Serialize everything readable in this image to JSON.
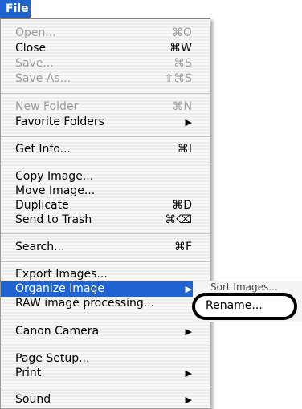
{
  "menubar": {
    "title": "File"
  },
  "menu": {
    "items": [
      {
        "label": "Open...",
        "shortcut": "⌘O",
        "disabled": true
      },
      {
        "label": "Close",
        "shortcut": "⌘W"
      },
      {
        "label": "Save...",
        "shortcut": "⌘S",
        "disabled": true
      },
      {
        "label": "Save As...",
        "shortcut": "⇧⌘S",
        "disabled": true
      },
      {
        "label": "New Folder",
        "shortcut": "⌘N",
        "disabled": true
      },
      {
        "label": "Favorite Folders",
        "submenu_arrow": "▶"
      },
      {
        "label": "Get Info...",
        "shortcut": "⌘I"
      },
      {
        "label": "Copy Image..."
      },
      {
        "label": "Move Image..."
      },
      {
        "label": "Duplicate",
        "shortcut": "⌘D"
      },
      {
        "label": "Send to Trash",
        "shortcut": "⌘⌫"
      },
      {
        "label": "Search...",
        "shortcut": "⌘F"
      },
      {
        "label": "Export Images..."
      },
      {
        "label": "Organize Image",
        "submenu_arrow": "▶",
        "highlighted": true
      },
      {
        "label": "RAW image processing..."
      },
      {
        "label": "Canon Camera",
        "submenu_arrow": "▶"
      },
      {
        "label": "Page Setup..."
      },
      {
        "label": "Print",
        "submenu_arrow": "▶"
      },
      {
        "label": "Sound",
        "submenu_arrow": "▶"
      }
    ]
  },
  "submenu": {
    "clipped_item": "Sort Images...",
    "items": [
      {
        "label": "Rename...",
        "callout": true
      }
    ]
  },
  "colors": {
    "highlight": "#1e63d0",
    "disabled_text": "#9c9c9c",
    "callout_border": "#000000"
  }
}
